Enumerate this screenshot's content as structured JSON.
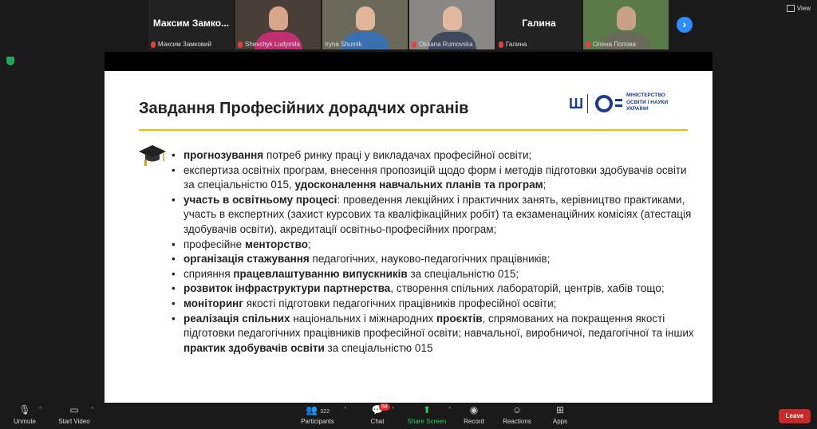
{
  "participants_strip": [
    {
      "big_name": "Максим  Замко...",
      "label": "Максим Замковий",
      "muted": true,
      "video": false
    },
    {
      "big_name": "",
      "label": "Shevchyk  Ludymila",
      "muted": true,
      "video": true
    },
    {
      "big_name": "",
      "label": "Iryna Shumik",
      "muted": false,
      "video": true
    },
    {
      "big_name": "",
      "label": "Oksana Rumovska",
      "muted": true,
      "video": true
    },
    {
      "big_name": "Галина",
      "label": "Галина",
      "muted": true,
      "video": false
    },
    {
      "big_name": "",
      "label": "Олена Попова",
      "muted": true,
      "video": true
    }
  ],
  "view_label": "View",
  "slide": {
    "title": "Завдання Професійних дорадчих органів",
    "logo_lines": [
      "МІНІСТЕРСТВО",
      "ОСВІТИ І НАУКИ",
      "УКРАЇНИ"
    ],
    "items": [
      [
        {
          "t": "прогнозування",
          "b": true
        },
        {
          "t": " потреб ринку праці у викладачах професійної освіти;",
          "b": false
        }
      ],
      [
        {
          "t": "експертиза освітніх програм, внесення пропозицій щодо форм і методів підготовки здобувачів освіти за спеціальністю 015, ",
          "b": false
        },
        {
          "t": "удосконалення навчальних планів та програм",
          "b": true
        },
        {
          "t": ";",
          "b": false
        }
      ],
      [
        {
          "t": "участь в освітньому процесі",
          "b": true
        },
        {
          "t": ": проведення лекційних і практичних занять, керівництво практиками, участь в експертних (захист курсових та кваліфікаційних робіт) та екзаменаційних комісіях (атестація здобувачів освіти), акредитації освітньо-професійних програм;",
          "b": false
        }
      ],
      [
        {
          "t": "професійне ",
          "b": false
        },
        {
          "t": "менторство",
          "b": true
        },
        {
          "t": ";",
          "b": false
        }
      ],
      [
        {
          "t": "організація стажування",
          "b": true
        },
        {
          "t": " педагогічних, науково-педагогічних працівників;",
          "b": false
        }
      ],
      [
        {
          "t": "сприяння ",
          "b": false
        },
        {
          "t": "працевлаштуванню випускників",
          "b": true
        },
        {
          "t": " за спеціальністю 015;",
          "b": false
        }
      ],
      [
        {
          "t": "розвиток інфраструктури партнерства",
          "b": true
        },
        {
          "t": ", створення спільних лабораторій, центрів, хабів тощо;",
          "b": false
        }
      ],
      [
        {
          "t": "моніторинг",
          "b": true
        },
        {
          "t": " якості підготовки педагогічних працівників професійної освіти;",
          "b": false
        }
      ],
      [
        {
          "t": "реалізація спільних",
          "b": true
        },
        {
          "t": " національних і міжнародних ",
          "b": false
        },
        {
          "t": "проєктів",
          "b": true
        },
        {
          "t": ", спрямованих на покращення якості підготовки педагогічних працівників професійної освіти; навчальної, виробничої, педагогічної та інших ",
          "b": false
        },
        {
          "t": "практик здобувачів освіти",
          "b": true
        },
        {
          "t": " за спеціальністю 015",
          "b": false
        }
      ]
    ]
  },
  "toolbar": {
    "unmute": "Unmute",
    "start_video": "Start Video",
    "participants": "Participants",
    "participants_count": "322",
    "chat": "Chat",
    "chat_badge": "58",
    "share_screen": "Share Screen",
    "record": "Record",
    "reactions": "Reactions",
    "apps": "Apps",
    "leave": "Leave"
  },
  "colors": {
    "accent_blue": "#2d8cff",
    "leave_red": "#c62b2b",
    "share_green": "#23d160",
    "gold_line": "#e8c200",
    "logo_blue": "#1a3c8c"
  }
}
